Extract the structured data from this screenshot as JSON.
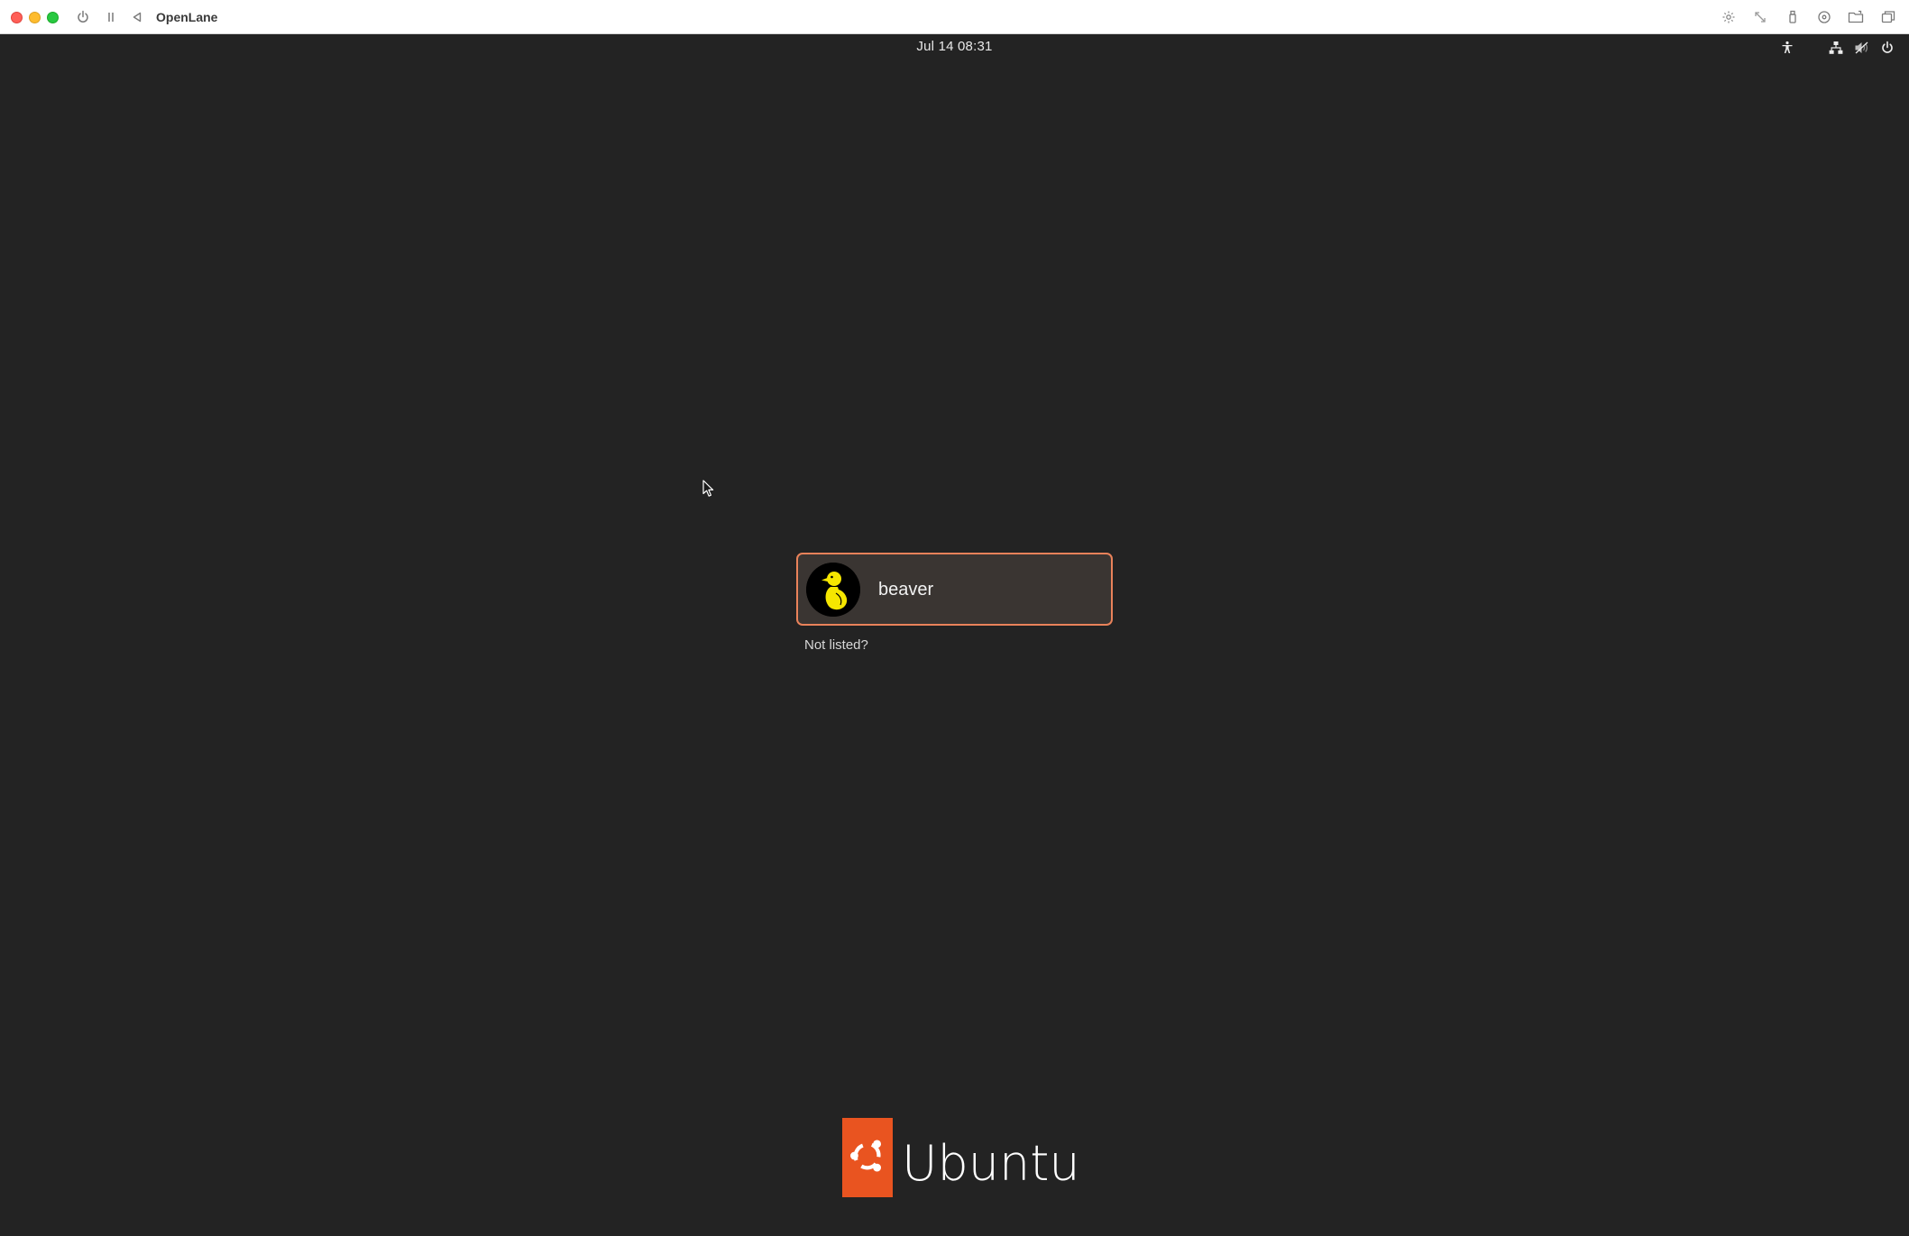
{
  "window": {
    "title": "OpenLane",
    "toolbar_left": [
      "power-icon",
      "pause-icon",
      "back-triangle-icon"
    ],
    "toolbar_right": [
      "brightness-icon",
      "resize-arrows-icon",
      "usb-icon",
      "disc-icon",
      "shared-folder-icon",
      "window-icon"
    ]
  },
  "top_panel": {
    "datetime": "Jul 14  08:31",
    "icons": [
      "accessibility-icon",
      "network-icon",
      "volume-icon",
      "power-icon"
    ]
  },
  "login": {
    "user_name": "beaver",
    "avatar_icon": "duck-icon",
    "not_listed_label": "Not listed?"
  },
  "branding": {
    "wordmark": "Ubuntu",
    "logo_icon": "ubuntu-circle-of-friends-icon"
  },
  "colors": {
    "background": "#232323",
    "accent": "#e95420",
    "card_border": "#e9825a",
    "card_fill": "#3a3532"
  }
}
